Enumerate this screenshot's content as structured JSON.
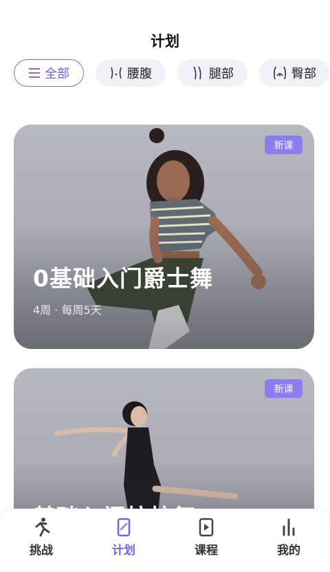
{
  "header": {
    "title": "计划"
  },
  "filters": [
    {
      "label": "全部",
      "icon": "list-icon",
      "active": true
    },
    {
      "label": "腰腹",
      "icon": "waist-icon",
      "active": false
    },
    {
      "label": "腿部",
      "icon": "legs-icon",
      "active": false
    },
    {
      "label": "臀部",
      "icon": "hips-icon",
      "active": false
    }
  ],
  "cards": [
    {
      "badge": "新课",
      "title": "0基础入门爵士舞",
      "subtitle": "4周 · 每周5天"
    },
    {
      "badge": "新课",
      "title": "基础入门拉拉舞"
    }
  ],
  "tabbar": [
    {
      "label": "挑战",
      "icon": "challenge-icon"
    },
    {
      "label": "计划",
      "icon": "plan-icon",
      "active": true
    },
    {
      "label": "课程",
      "icon": "course-icon"
    },
    {
      "label": "我的",
      "icon": "profile-icon"
    }
  ],
  "colors": {
    "accent": "#7d6ee0",
    "badge": "#8b7cf0",
    "chip_bg": "#f3f1f8"
  }
}
